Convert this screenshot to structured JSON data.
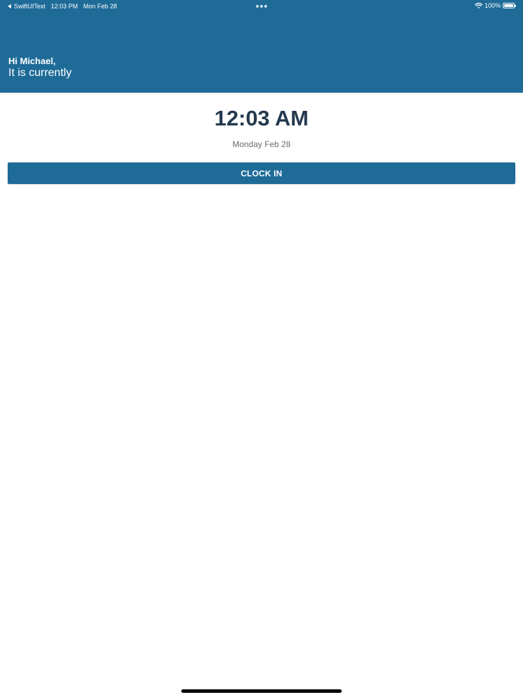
{
  "status_bar": {
    "back_app": "SwiftUIText",
    "time": "12:03 PM",
    "date": "Mon Feb 28",
    "battery": "100%"
  },
  "header": {
    "greeting": "Hi Michael,",
    "subtitle": "It is currently"
  },
  "clock": {
    "time": "12:03 AM",
    "date": "Monday Feb 28"
  },
  "actions": {
    "clock_in_label": "CLOCK IN"
  },
  "icons": {
    "back": "back-arrow-icon",
    "multitask": "multitasking-dots-icon",
    "wifi": "wifi-icon",
    "battery": "battery-icon"
  },
  "colors": {
    "brand_blue": "#1e6b98",
    "time_text": "#253a4f",
    "date_text": "#6b6b6b",
    "background": "#ffffff"
  }
}
